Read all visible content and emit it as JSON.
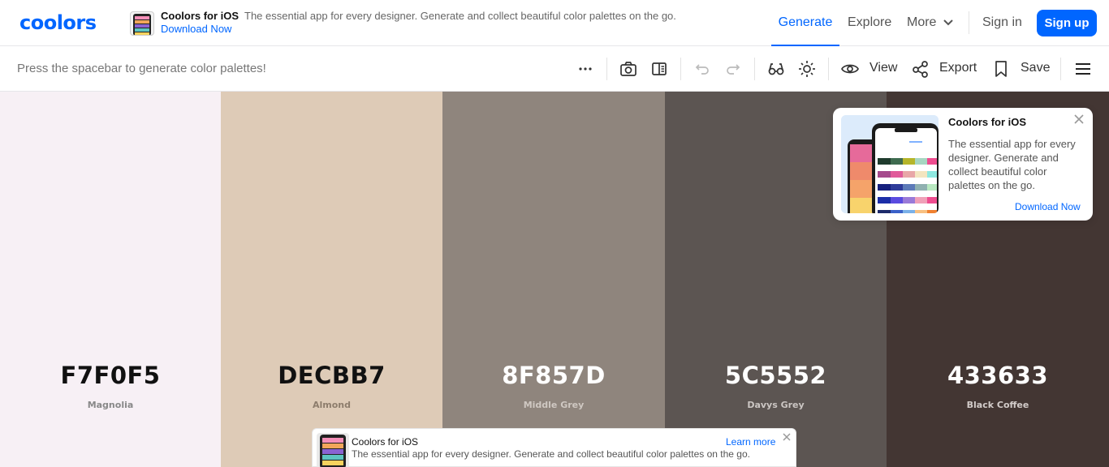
{
  "brand": {
    "logo_text": "coolors",
    "accent": "#0066ff"
  },
  "topnav": {
    "promo": {
      "title": "Coolors for iOS",
      "description": "The essential app for every designer. Generate and collect beautiful color palettes on the go.",
      "link": "Download Now",
      "thumb_icon": "phone-app-icon"
    },
    "links": {
      "generate": "Generate",
      "explore": "Explore",
      "more": "More",
      "signin": "Sign in",
      "signup": "Sign up"
    }
  },
  "toolbar": {
    "hint": "Press the spacebar to generate color palettes!",
    "icons": [
      "more-icon",
      "camera-icon",
      "sidebar-panel-icon",
      "undo-icon",
      "redo-icon",
      "glasses-icon",
      "sun-icon",
      "eye-icon",
      "share-icon",
      "bookmark-icon",
      "hamburger-menu-icon"
    ],
    "view_label": "View",
    "export_label": "Export",
    "save_label": "Save"
  },
  "palette": [
    {
      "hex": "F7F0F5",
      "name": "Magnolia",
      "color": "#F7F0F5",
      "hex_color": "#111111",
      "name_color": "#888888"
    },
    {
      "hex": "DECBB7",
      "name": "Almond",
      "color": "#DECBB7",
      "hex_color": "#111111",
      "name_color": "#8d7d6c"
    },
    {
      "hex": "8F857D",
      "name": "Middle Grey",
      "color": "#8F857D",
      "hex_color": "#ffffff",
      "name_color": "#cfc8c2"
    },
    {
      "hex": "5C5552",
      "name": "Davys Grey",
      "color": "#5C5552",
      "hex_color": "#ffffff",
      "name_color": "#cbc6c3"
    },
    {
      "hex": "433633",
      "name": "Black Coffee",
      "color": "#433633",
      "hex_color": "#ffffff",
      "name_color": "#d3ccca"
    }
  ],
  "promo_card": {
    "title": "Coolors for iOS",
    "description": "The essential app for every designer. Generate and collect beautiful color palettes on the go.",
    "link": "Download Now"
  },
  "bottom_banner": {
    "title": "Coolors for iOS",
    "description": "The essential app for every designer. Generate and collect beautiful color palettes on the go.",
    "link": "Learn more"
  }
}
